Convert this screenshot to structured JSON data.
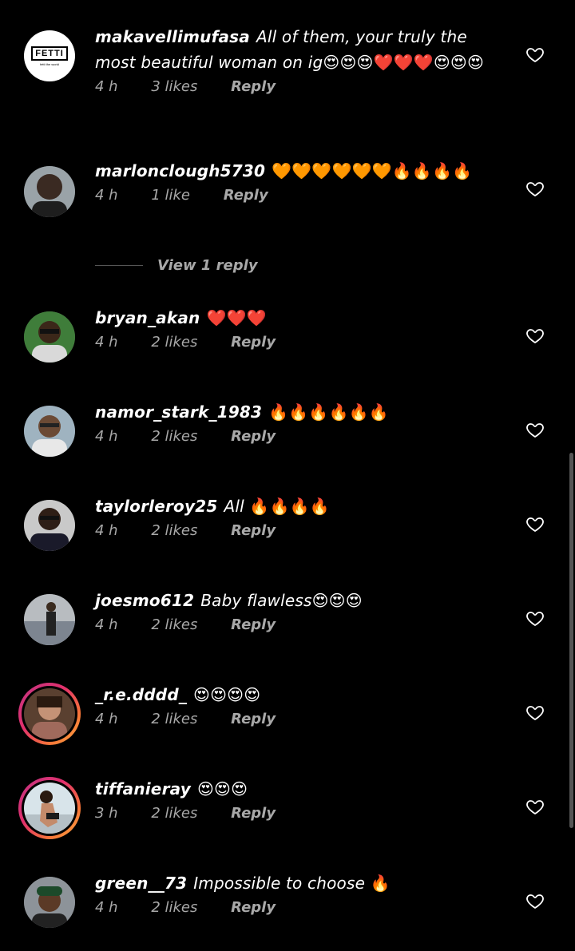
{
  "comments": [
    {
      "username": "makavellimufasa",
      "text": "All of them, your truly the most beautiful woman on ig",
      "emoji": "😍😍😍❤️❤️❤️😍😍😍",
      "time": "4 h",
      "likes": "3 likes",
      "reply": "Reply",
      "avatar": "fetti-logo"
    },
    {
      "username": "marlonclough5730",
      "text": "",
      "emoji": "🧡🧡🧡🧡🧡🧡🔥🔥🔥🔥",
      "time": "4 h",
      "likes": "1 like",
      "reply": "Reply",
      "avatar": "man-photo"
    },
    {
      "username": "bryan_akan",
      "text": "",
      "emoji": "❤️❤️❤️",
      "time": "4 h",
      "likes": "2 likes",
      "reply": "Reply",
      "avatar": "man-photo"
    },
    {
      "username": "namor_stark_1983",
      "text": "",
      "emoji": "🔥🔥🔥🔥🔥🔥",
      "time": "4 h",
      "likes": "2 likes",
      "reply": "Reply",
      "avatar": "man-photo"
    },
    {
      "username": "taylorleroy25",
      "text": "All",
      "emoji": "🔥🔥🔥🔥",
      "time": "4 h",
      "likes": "2 likes",
      "reply": "Reply",
      "avatar": "man-photo"
    },
    {
      "username": "joesmo612",
      "text": "Baby flawless",
      "emoji": "😍😍😍",
      "time": "4 h",
      "likes": "2 likes",
      "reply": "Reply",
      "avatar": "man-photo"
    },
    {
      "username": "_r.e.dddd_",
      "text": "",
      "emoji": "😍😍😍😍",
      "time": "4 h",
      "likes": "2 likes",
      "reply": "Reply",
      "avatar": "woman-photo-story"
    },
    {
      "username": "tiffanieray",
      "text": "",
      "emoji": "😍😍😍",
      "time": "3 h",
      "likes": "2 likes",
      "reply": "Reply",
      "avatar": "woman-photo-story"
    },
    {
      "username": "green__73",
      "text": "Impossible to choose",
      "emoji": "🔥",
      "time": "4 h",
      "likes": "2 likes",
      "reply": "Reply",
      "avatar": "man-photo"
    }
  ],
  "view_replies": "View 1 reply",
  "logo_text": "FETTI",
  "logo_tagline": "fetti the world",
  "icons": {
    "like": "heart-outline-icon"
  },
  "colors": {
    "background": "#000000",
    "text": "#ffffff",
    "meta": "#a8a8a8",
    "story_ring": [
      "#c13584",
      "#f77737",
      "#fcaf45"
    ]
  }
}
